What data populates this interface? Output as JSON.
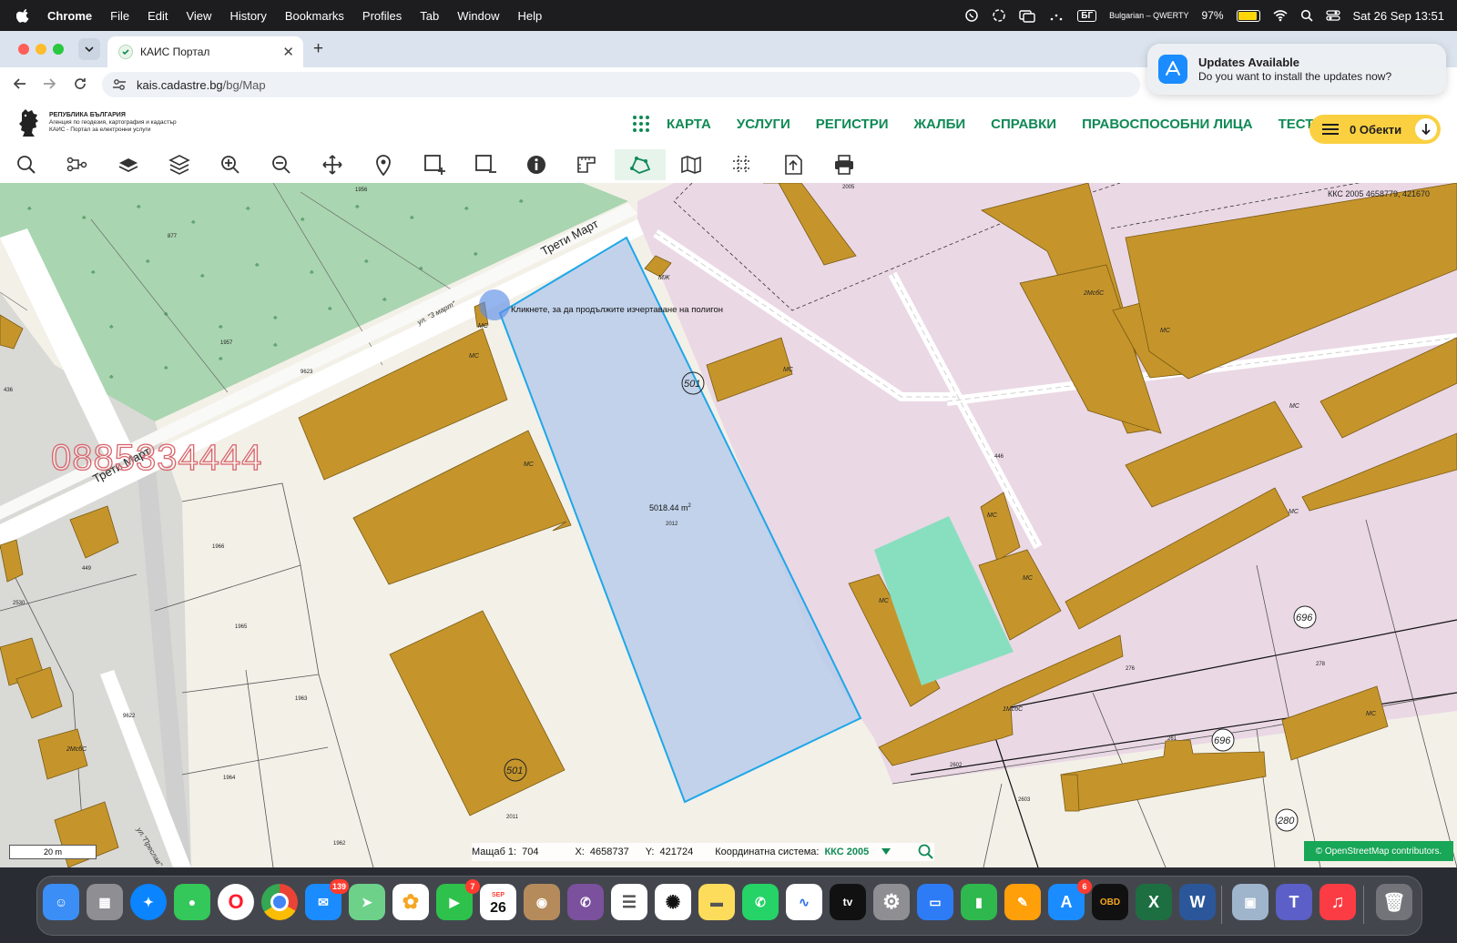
{
  "menubar": {
    "items": [
      "Chrome",
      "File",
      "Edit",
      "View",
      "History",
      "Bookmarks",
      "Profiles",
      "Tab",
      "Window",
      "Help"
    ],
    "keyboard_flag": "БГ",
    "keyboard_name": "Bulgarian – QWERTY",
    "battery": "97%",
    "datetime": "Sat 26 Sep  13:51"
  },
  "browser": {
    "tab_title": "КАИС Портал",
    "url_host": "kais.cadastre.bg",
    "url_path": "/bg/Map"
  },
  "notification": {
    "title": "Updates Available",
    "message": "Do you want to install the updates now?"
  },
  "site": {
    "logo_lines": [
      "РЕПУБЛИКА БЪЛГАРИЯ",
      "Агенция по геодезия, картография и кадастър",
      "КАИС - Портал за електронни услуги"
    ],
    "nav": [
      "КАРТА",
      "УСЛУГИ",
      "РЕГИСТРИ",
      "ЖАЛБИ",
      "СПРАВКИ",
      "ПРАВОСПОСОБНИ ЛИЦА",
      "ТЕСТ"
    ],
    "objects_button": "0 Обекти"
  },
  "toolbar": {
    "tools": [
      "search-icon",
      "identify-layers-icon",
      "layer-icon",
      "layers-stack-icon",
      "zoom-in-icon",
      "zoom-out-icon",
      "pan-icon",
      "pin-icon",
      "select-add-icon",
      "select-remove-icon",
      "info-icon",
      "measure-icon",
      "polygon-icon",
      "map-icon",
      "grid-icon",
      "export-icon",
      "print-icon"
    ],
    "active_tool": "polygon-icon"
  },
  "map": {
    "coords_top_right": "ККС 2005 4658779, 421670",
    "phone_watermark": "0885334444",
    "drawing_hint": "Кликнете, за да продължите изчертаване на полигон",
    "area": "5018.44 m",
    "area_sup": "2",
    "street_labels": [
      "Трети Март",
      "Трети Март",
      "ул. \"3 март\"",
      "ул.\"Преслав\""
    ],
    "parcel_numbers": [
      "1956",
      "877",
      "1957",
      "9623",
      "436",
      "1966",
      "1965",
      "1963",
      "1964",
      "2530",
      "449",
      "9622",
      "2012",
      "2011",
      "1962",
      "2005",
      "446",
      "2602",
      "2603",
      "276",
      "278",
      "261"
    ],
    "building_labels": [
      "МС",
      "МС",
      "МС",
      "МС",
      "МЖ",
      "МС",
      "2МсбС",
      "МС",
      "МС",
      "МС",
      "МС",
      "МС",
      "1МсбС",
      "2МсбС",
      "МС"
    ],
    "circle_numbers": [
      "501",
      "501",
      "696",
      "696",
      "280"
    ],
    "scale_label": "20 m",
    "status": {
      "scale_label": "Мащаб 1:",
      "scale_value": "704",
      "x_label": "X:",
      "x_value": "4658737",
      "y_label": "Y:",
      "y_value": "421724",
      "cs_label": "Координатна система:",
      "cs_value": "ККС 2005"
    },
    "attribution": "© OpenStreetMap contributors."
  },
  "dock": {
    "items": [
      "Finder",
      "Launchpad",
      "Safari",
      "Messages",
      "Opera",
      "Chrome",
      "Mail",
      "Maps",
      "Photos",
      "FaceTime",
      "Calendar",
      "Contacts",
      "Viber",
      "Reminders",
      "ChatGPT",
      "Notes",
      "WhatsApp",
      "Freeform",
      "TV",
      "System Settings",
      "Keynote",
      "Numbers",
      "Pages",
      "App Store",
      "OBD",
      "Excel",
      "Word",
      "Preview",
      "Teams",
      "Music",
      "Trash"
    ],
    "mail_badge": "139",
    "facetime_badge": "7",
    "appstore_badge": "6",
    "calendar_month": "SEP",
    "calendar_day": "26",
    "obd_label": "OBD"
  },
  "colors": {
    "building": "#c5952c",
    "green_area": "#a9d5b0",
    "pink_area": "#ead8e5",
    "polygon_fill": "#b9cdea",
    "polygon_stroke": "#1ea7e8",
    "nav_green": "#0f8a55",
    "objects_yellow": "#fad041"
  }
}
